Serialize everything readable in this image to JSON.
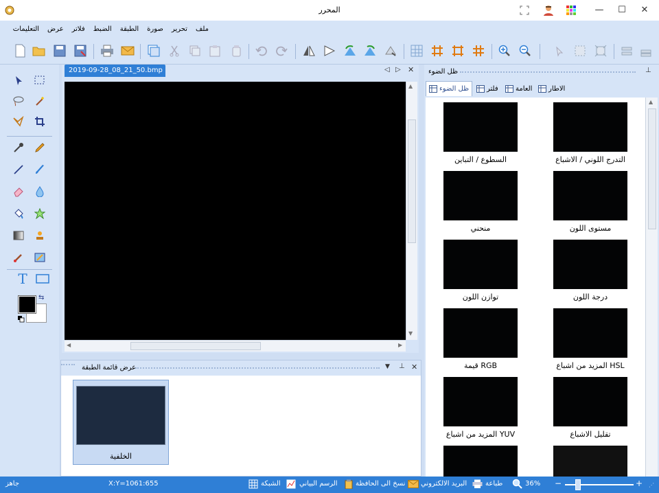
{
  "window": {
    "title": "المحرر",
    "minimize_glyph": "—",
    "maximize_glyph": "☐",
    "close_glyph": "✕"
  },
  "menu": [
    "ملف",
    "تحرير",
    "صورة",
    "الطبقة",
    "الضبط",
    "فلاتر",
    "عرض",
    "التعليمات"
  ],
  "toolbar_icons": [
    "new-file-icon",
    "open-folder-icon",
    "save-icon",
    "save-as-icon",
    "print-icon",
    "email-icon",
    "copy-canvas-icon",
    "cut-icon",
    "copy-icon",
    "paste-icon",
    "paste-new-icon",
    "undo-icon",
    "redo-icon",
    "flip-horizontal-icon",
    "flip-vertical-icon",
    "rotate-left-icon",
    "rotate-right-icon",
    "rotate-free-icon",
    "grid-icon",
    "grid-orange-icon",
    "frame-icon",
    "hash-icon",
    "zoom-in-icon",
    "zoom-out-icon",
    "select-arrow-icon",
    "crop-selection-icon",
    "expand-selection-icon",
    "align-top-icon",
    "align-bottom-icon"
  ],
  "document": {
    "tab_label": "2019-09-28_08_21_50.bmp",
    "nav_prev": "◁",
    "nav_next": "▷",
    "close": "✕"
  },
  "layer_panel": {
    "title": "عرض قائمة الطبقة",
    "layer_name": "الخلفية"
  },
  "right_panel": {
    "title": "ظل الضوء",
    "tabs": [
      "الاطار",
      "العامة",
      "فلتر",
      "ظل الضوء"
    ],
    "filters": [
      "التدرج اللوني / الاشباع",
      "السطوع / التباين",
      "مستوى اللون",
      "منحني",
      "درجة اللون",
      "توازن اللون",
      "HSL المزيد من اشباع",
      "RGB قيمة",
      "تقليل الاشباع",
      "YUV المزيد من اشباع"
    ]
  },
  "status": {
    "ready": "جاهز",
    "coords": "X:Y=1061:655",
    "grid": "الشبكة",
    "chart": "الرسم البياني",
    "clipboard": "نسخ الى الحافظة",
    "email": "البريد الالكتروني",
    "print": "طباعة",
    "zoom": "36%",
    "zoom_level": 0.36,
    "minus": "−",
    "plus": "+"
  },
  "colors": {
    "accent": "#2f7fd6",
    "panel": "#d6e4f7",
    "foreground_color": "#000000",
    "background_color": "#ffffff"
  }
}
